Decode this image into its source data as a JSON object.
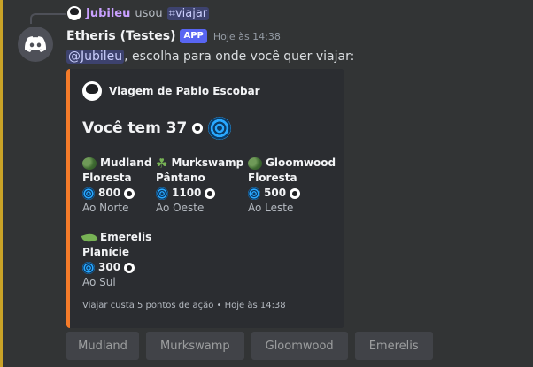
{
  "reply": {
    "username": "Jubileu",
    "used": "usou",
    "command": "viajar"
  },
  "message": {
    "bot_name": "Etheris (Testes)",
    "app_tag": "APP",
    "timestamp": "Hoje às 14:38",
    "mention": "@Jubileu",
    "text": ", escolha para onde você quer viajar:"
  },
  "embed": {
    "accent_color": "#f47b2a",
    "author": "Viagem de Pablo Escobar",
    "title": "Você tem 37",
    "destinations": [
      {
        "icon": "bush-icon",
        "name": "Mudland",
        "biome": "Floresta",
        "cost": "800",
        "direction": "Ao Norte"
      },
      {
        "icon": "shamrock-icon",
        "name": "Murkswamp",
        "biome": "Pântano",
        "cost": "1100",
        "direction": "Ao Oeste"
      },
      {
        "icon": "bush-icon",
        "name": "Gloomwood",
        "biome": "Floresta",
        "cost": "500",
        "direction": "Ao Leste"
      },
      {
        "icon": "leaf-icon",
        "name": "Emerelis",
        "biome": "Planície",
        "cost": "300",
        "direction": "Ao Sul"
      }
    ],
    "footer": "Viajar custa 5 pontos de ação • Hoje às 14:38"
  },
  "buttons": [
    "Mudland",
    "Murkswamp",
    "Gloomwood",
    "Emerelis"
  ]
}
